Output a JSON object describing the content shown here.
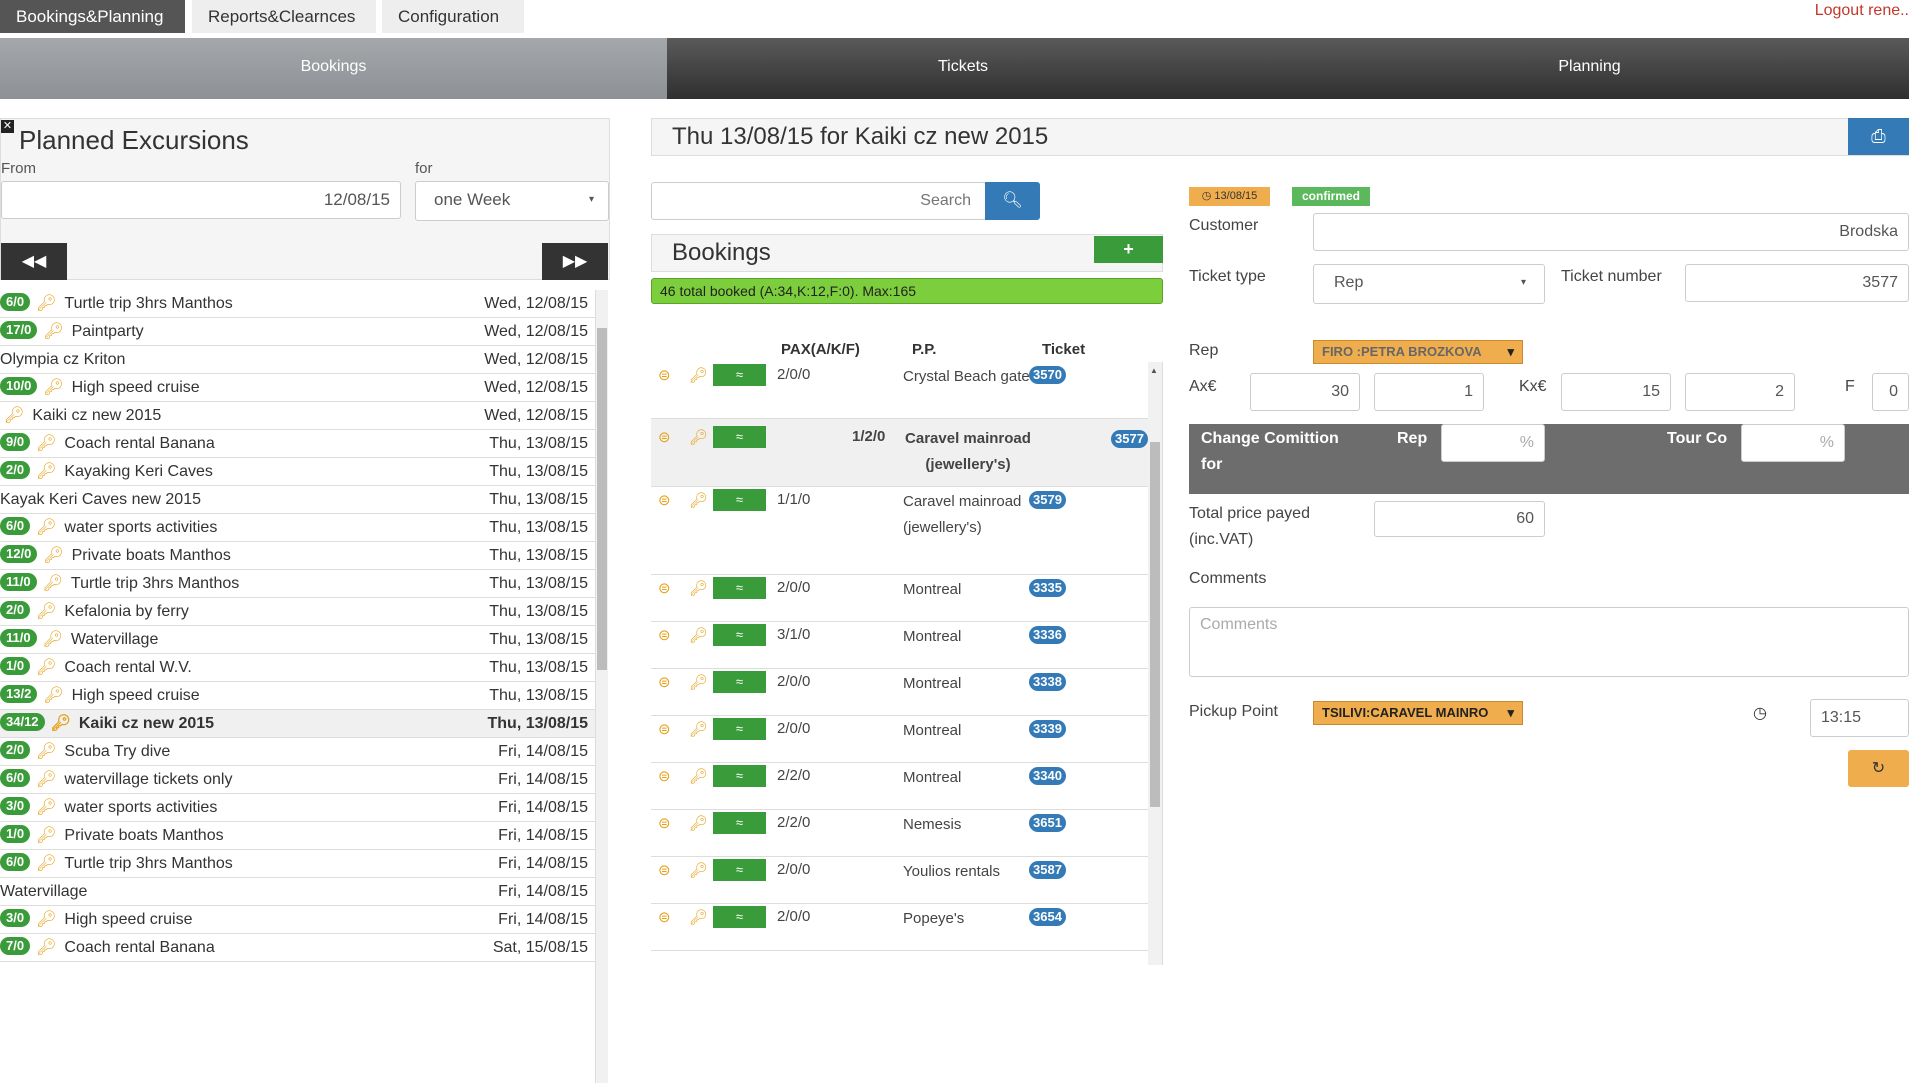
{
  "topnav": {
    "tabs": [
      "Bookings&Planning",
      "Reports&Clearnces",
      "Configuration"
    ],
    "logout": "Logout rene.."
  },
  "subnav": [
    "Bookings",
    "Tickets",
    "Planning"
  ],
  "left": {
    "title": "Planned Excursions",
    "from_label": "From",
    "from_value": "12/08/15",
    "for_label": "for",
    "for_value": "one Week",
    "excursions": [
      {
        "badge": "6/0",
        "name": "Turtle trip 3hrs Manthos",
        "date": "Wed, 12/08/15",
        "key": true
      },
      {
        "badge": "17/0",
        "name": "Paintparty",
        "date": "Wed, 12/08/15",
        "key": true
      },
      {
        "badge": "",
        "name": "Olympia cz Kriton",
        "date": "Wed, 12/08/15",
        "key": false
      },
      {
        "badge": "10/0",
        "name": "High speed cruise",
        "date": "Wed, 12/08/15",
        "key": true
      },
      {
        "badge": "",
        "name": "Kaiki cz new 2015",
        "date": "Wed, 12/08/15",
        "key": true
      },
      {
        "badge": "9/0",
        "name": "Coach rental Banana",
        "date": "Thu, 13/08/15",
        "key": true
      },
      {
        "badge": "2/0",
        "name": "Kayaking Keri Caves",
        "date": "Thu, 13/08/15",
        "key": true
      },
      {
        "badge": "",
        "name": "Kayak Keri Caves new 2015",
        "date": "Thu, 13/08/15",
        "key": false
      },
      {
        "badge": "6/0",
        "name": "water sports activities",
        "date": "Thu, 13/08/15",
        "key": true
      },
      {
        "badge": "12/0",
        "name": "Private boats Manthos",
        "date": "Thu, 13/08/15",
        "key": true
      },
      {
        "badge": "11/0",
        "name": "Turtle trip 3hrs Manthos",
        "date": "Thu, 13/08/15",
        "key": true
      },
      {
        "badge": "2/0",
        "name": "Kefalonia by ferry",
        "date": "Thu, 13/08/15",
        "key": true
      },
      {
        "badge": "11/0",
        "name": "Watervillage",
        "date": "Thu, 13/08/15",
        "key": true
      },
      {
        "badge": "1/0",
        "name": "Coach rental W.V.",
        "date": "Thu, 13/08/15",
        "key": true
      },
      {
        "badge": "13/2",
        "name": "High speed cruise",
        "date": "Thu, 13/08/15",
        "key": true
      },
      {
        "badge": "34/12",
        "name": "Kaiki cz new 2015",
        "date": "Thu, 13/08/15",
        "key": true,
        "bold": true
      },
      {
        "badge": "2/0",
        "name": "Scuba Try dive",
        "date": "Fri, 14/08/15",
        "key": true
      },
      {
        "badge": "6/0",
        "name": "watervillage tickets only",
        "date": "Fri, 14/08/15",
        "key": true
      },
      {
        "badge": "3/0",
        "name": "water sports activities",
        "date": "Fri, 14/08/15",
        "key": true
      },
      {
        "badge": "1/0",
        "name": "Private boats Manthos",
        "date": "Fri, 14/08/15",
        "key": true
      },
      {
        "badge": "6/0",
        "name": "Turtle trip 3hrs Manthos",
        "date": "Fri, 14/08/15",
        "key": true
      },
      {
        "badge": "",
        "name": "Watervillage",
        "date": "Fri, 14/08/15",
        "key": false
      },
      {
        "badge": "3/0",
        "name": "High speed cruise",
        "date": "Fri, 14/08/15",
        "key": true
      },
      {
        "badge": "7/0",
        "name": "Coach rental Banana",
        "date": "Sat, 15/08/15",
        "key": true
      }
    ]
  },
  "middle": {
    "title": "Thu 13/08/15 for Kaiki cz new 2015",
    "search_placeholder": "Search",
    "bookings_title": "Bookings",
    "add_label": "+",
    "total": "46 total booked (A:34,K:12,F:0). Max:165",
    "columns": {
      "pax": "PAX(A/K/F)",
      "pp": "P.P.",
      "ticket": "Ticket"
    },
    "bookings": [
      {
        "pax": "2/0/0",
        "pp": "Crystal Beach gate",
        "ticket": "3570"
      },
      {
        "pax": "1/2/0",
        "pp": "Caravel mainroad (jewellery's)",
        "ticket": "3577",
        "selected": true
      },
      {
        "pax": "1/1/0",
        "pp": "Caravel mainroad (jewellery's)",
        "ticket": "3579"
      },
      {
        "pax": "2/0/0",
        "pp": "Montreal",
        "ticket": "3335"
      },
      {
        "pax": "3/1/0",
        "pp": "Montreal",
        "ticket": "3336"
      },
      {
        "pax": "2/0/0",
        "pp": "Montreal",
        "ticket": "3338"
      },
      {
        "pax": "2/0/0",
        "pp": "Montreal",
        "ticket": "3339"
      },
      {
        "pax": "2/2/0",
        "pp": "Montreal",
        "ticket": "3340"
      },
      {
        "pax": "2/2/0",
        "pp": "Nemesis",
        "ticket": "3651"
      },
      {
        "pax": "2/0/0",
        "pp": "Youlios rentals",
        "ticket": "3587"
      },
      {
        "pax": "2/0/0",
        "pp": "Popeye's",
        "ticket": "3654"
      }
    ]
  },
  "right": {
    "date_badge": "13/08/15",
    "status": "confirmed",
    "customer_label": "Customer",
    "customer_value": "Brodska",
    "ticket_type_label": "Ticket type",
    "ticket_type_value": "Rep",
    "ticket_number_label": "Ticket number",
    "ticket_number_value": "3577",
    "rep_label": "Rep",
    "rep_value": "FIRO :PETRA BROZKOVA",
    "ax_label": "Ax€",
    "ax_price": "30",
    "ax_count": "1",
    "kx_label": "Kx€",
    "kx_price": "15",
    "kx_count": "2",
    "f_label": "F",
    "f_value": "0",
    "commission_label": "Change Comittion for",
    "commission_rep": "Rep",
    "commission_tour": "Tour Co",
    "percent": "%",
    "total_label": "Total price payed (inc.VAT)",
    "total_value": "60",
    "comments_label": "Comments",
    "comments_placeholder": "Comments",
    "pickup_label": "Pickup Point",
    "pickup_value": "TSILIVI:CARAVEL MAINRO",
    "time_value": "13:15"
  }
}
